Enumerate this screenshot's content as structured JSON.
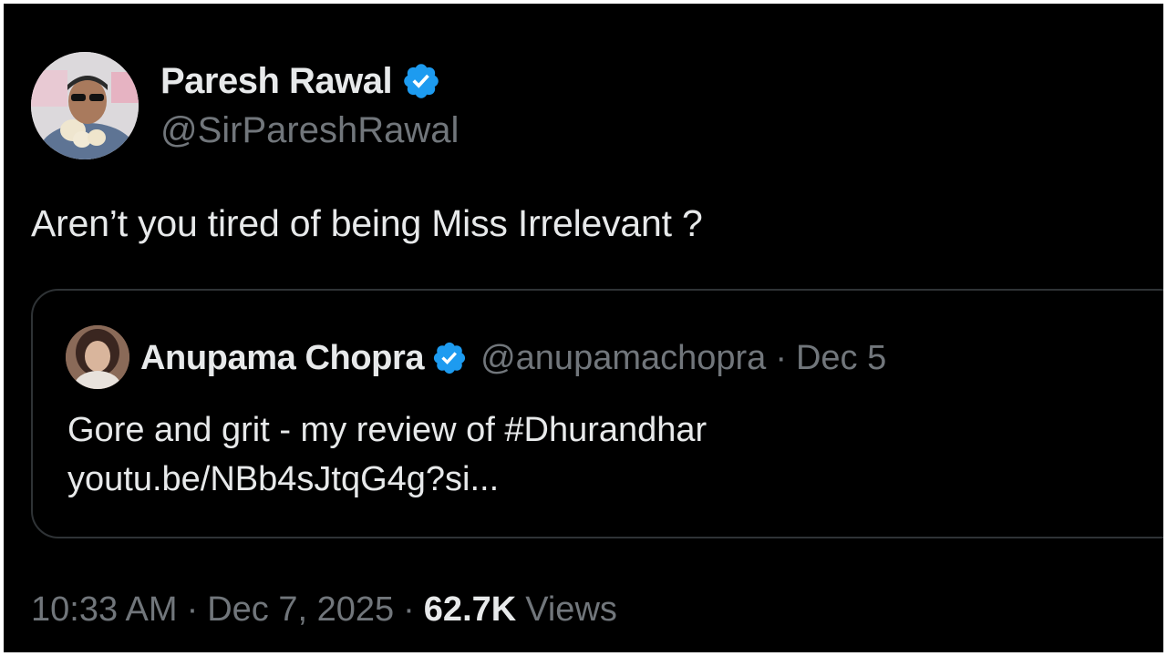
{
  "tweet": {
    "author": {
      "display_name": "Paresh Rawal",
      "handle": "@SirPareshRawal",
      "verified": true
    },
    "text": "Aren’t you tired of being Miss Irrelevant ?",
    "quoted_tweet": {
      "author": {
        "display_name": "Anupama Chopra",
        "handle": "@anupamachopra",
        "verified": true
      },
      "separator": "·",
      "date": "Dec 5",
      "text_line1": "Gore and grit - my review of #Dhurandhar",
      "text_line2": "youtu.be/NBb4sJtqG4g?si..."
    },
    "meta": {
      "time": "10:33 AM",
      "separator": "·",
      "date": "Dec 7, 2025",
      "views_count": "62.7K",
      "views_label": "Views"
    }
  },
  "colors": {
    "background": "#000000",
    "primary_text": "#e7e9ea",
    "secondary_text": "#71767b",
    "verified_badge": "#1d9bf0",
    "quote_border": "#2f3336"
  },
  "icons": {
    "verified": "verified-badge-icon"
  }
}
